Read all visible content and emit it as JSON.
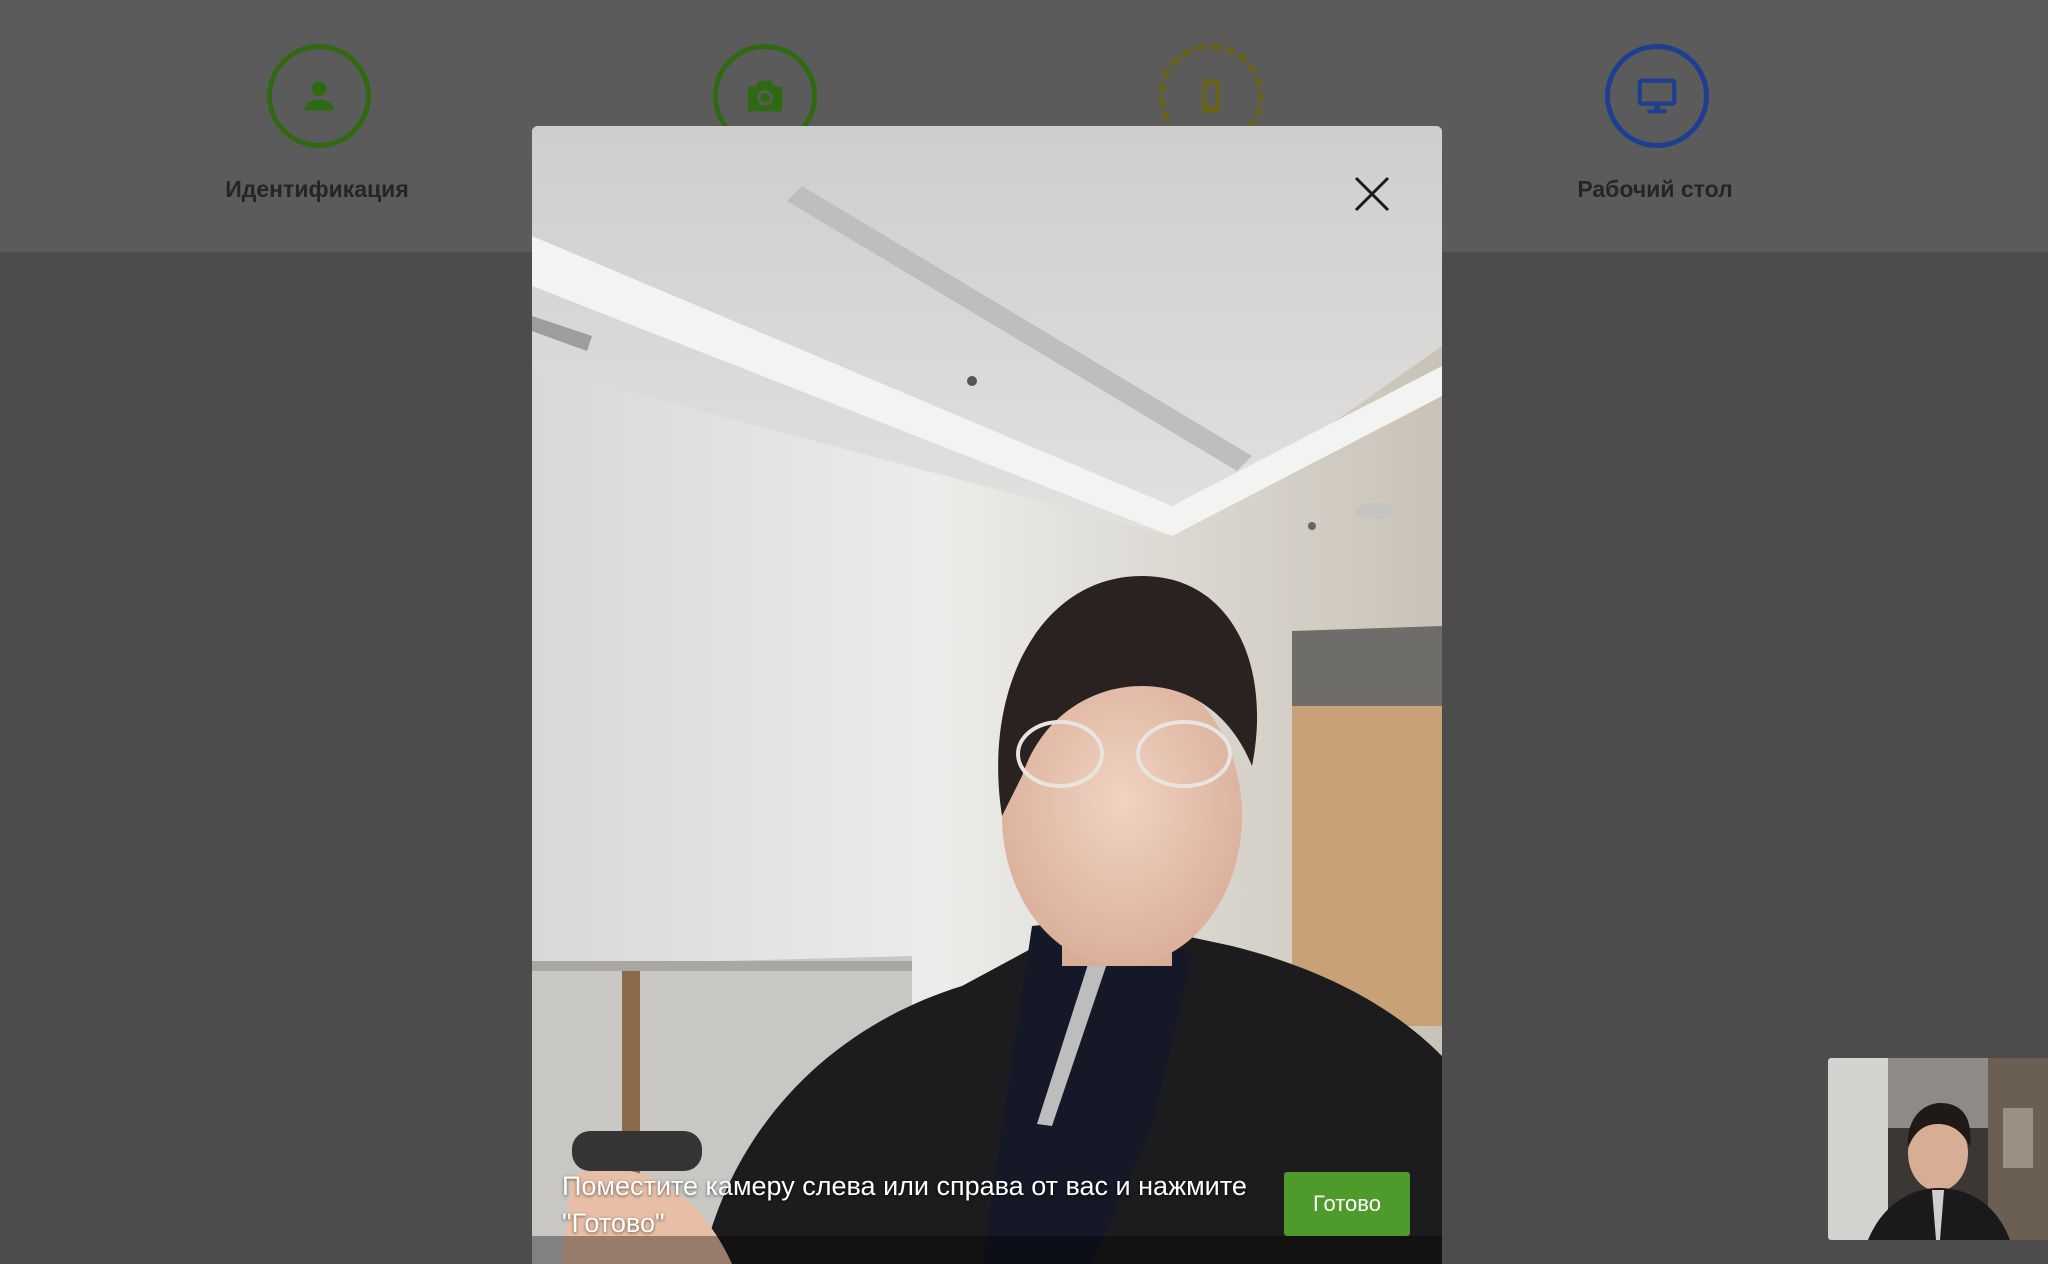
{
  "steps": [
    {
      "label": "Идентификация",
      "icon": "user-icon",
      "color": "#2f6a12"
    },
    {
      "label": "",
      "icon": "camera-icon",
      "color": "#2f6a12"
    },
    {
      "label": "",
      "icon": "phone-icon",
      "color": "#6a6314"
    },
    {
      "label": "Рабочий стол",
      "icon": "desktop-icon",
      "color": "#1e3f8f"
    }
  ],
  "modal": {
    "instruction": "Поместите камеру слева или справа от вас и нажмите \"Готово\"",
    "done_label": "Готово",
    "close_icon": "close-icon",
    "done_color": "#4e9b2b"
  },
  "pip": {
    "icon": "webcam-preview"
  }
}
